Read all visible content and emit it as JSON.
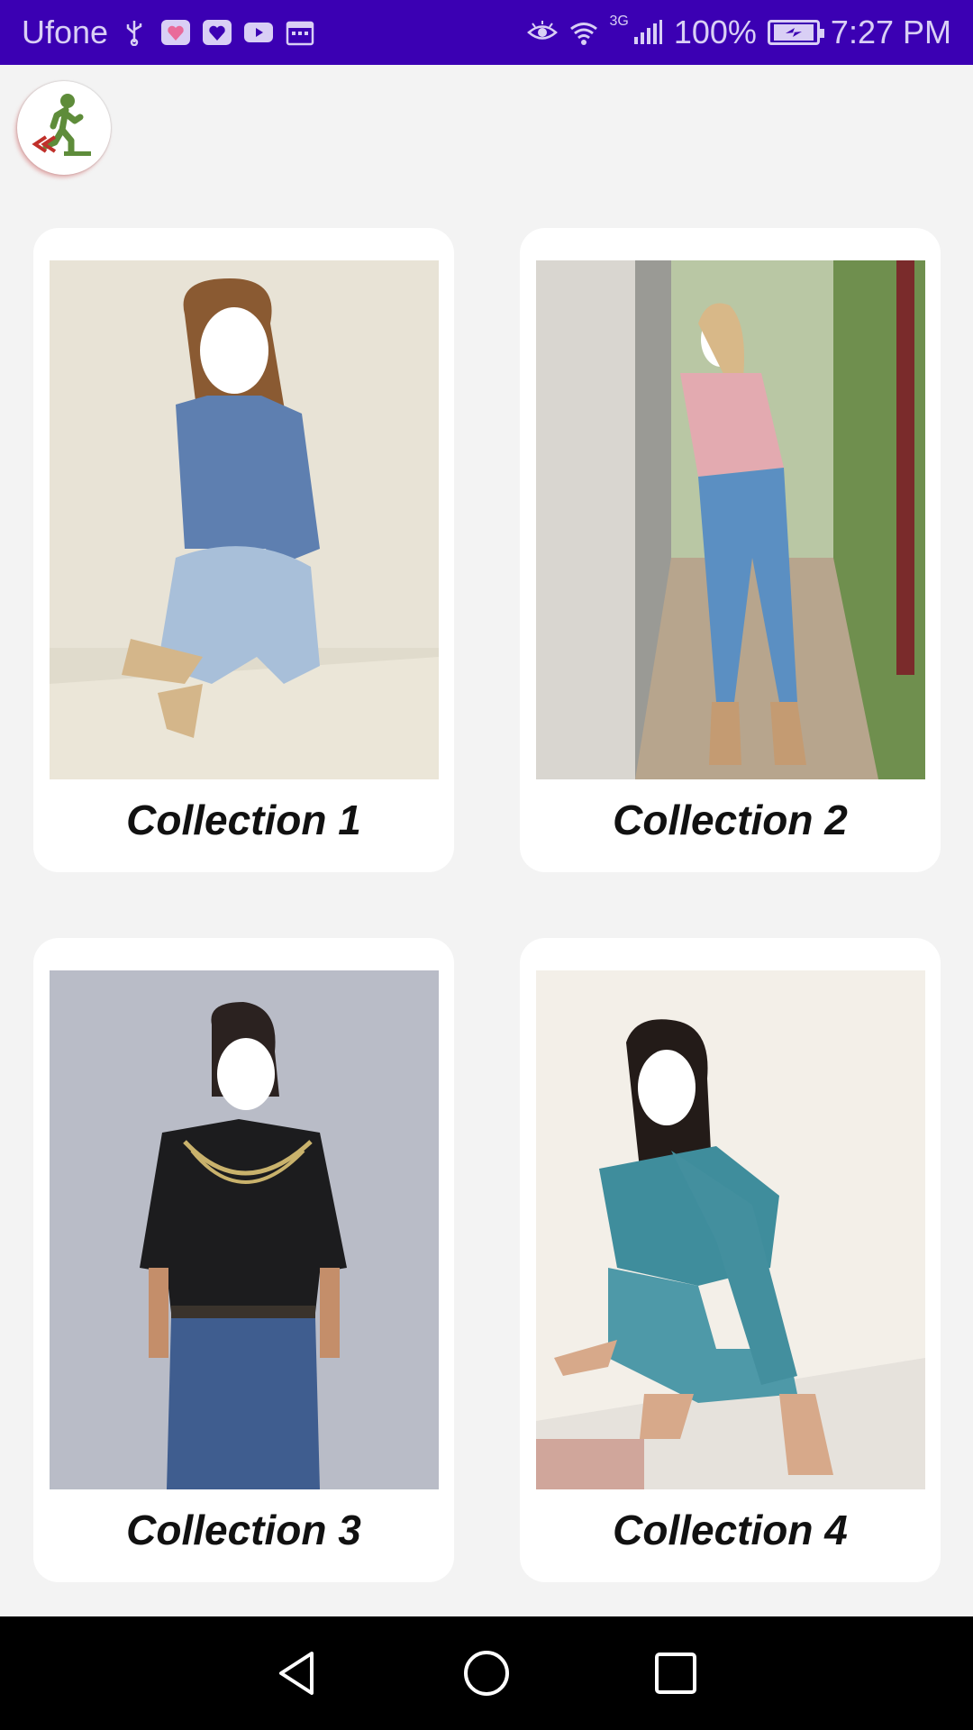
{
  "status_bar": {
    "carrier": "Ufone",
    "network_type": "3G",
    "battery": "100%",
    "time": "7:27 PM",
    "icons": [
      "usb-icon",
      "app-notification-icon",
      "heart-app-icon",
      "youtube-icon",
      "calendar-icon",
      "eye-icon",
      "wifi-icon",
      "signal-icon",
      "battery-charging-icon"
    ]
  },
  "header": {
    "back_icon": "exit-running-man-icon"
  },
  "collections": [
    {
      "label": "Collection 1",
      "photo": "woman-denim-jacket-sitting"
    },
    {
      "label": "Collection 2",
      "photo": "woman-pink-top-standing-outdoor"
    },
    {
      "label": "Collection 3",
      "photo": "woman-black-shirt-necklace"
    },
    {
      "label": "Collection 4",
      "photo": "woman-teal-denim-sitting"
    }
  ],
  "nav_bar": {
    "buttons": [
      "back-triangle-icon",
      "home-circle-icon",
      "recents-square-icon"
    ]
  },
  "colors": {
    "status_bar_bg": "#3b00b3",
    "page_bg": "#f3f3f3",
    "card_bg": "#ffffff",
    "nav_bar_bg": "#000000"
  }
}
